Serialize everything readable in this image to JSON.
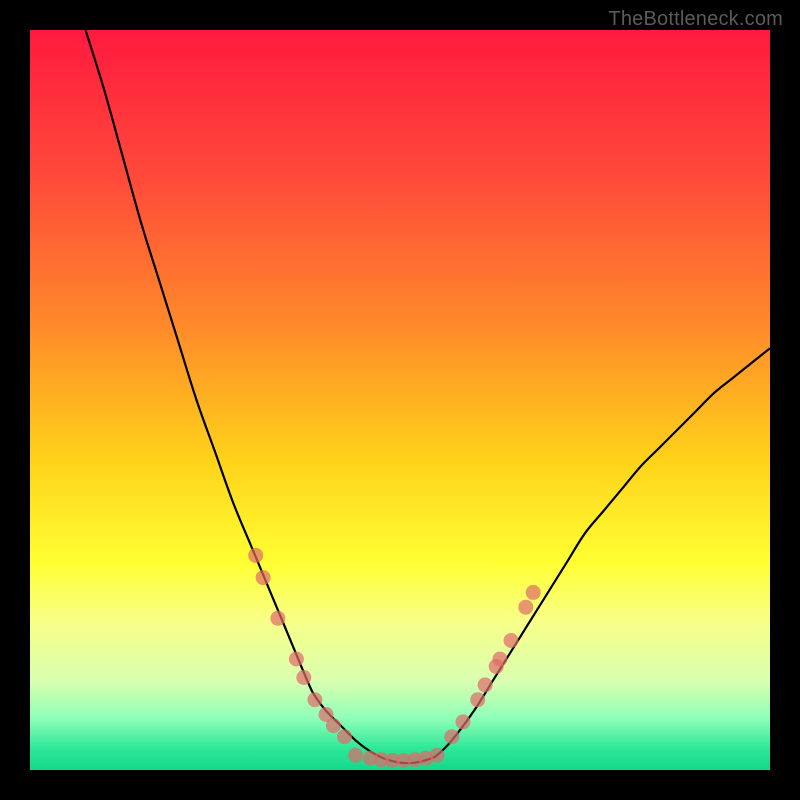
{
  "watermark": "TheBottleneck.com",
  "chart_data": {
    "type": "line",
    "title": "",
    "xlabel": "",
    "ylabel": "",
    "xlim": [
      0,
      100
    ],
    "ylim": [
      0,
      100
    ],
    "grid": false,
    "legend": false,
    "gradient_stops": [
      {
        "pos": 0.0,
        "color": "#ff1a3f"
      },
      {
        "pos": 0.2,
        "color": "#ff4a3a"
      },
      {
        "pos": 0.4,
        "color": "#ff8a2a"
      },
      {
        "pos": 0.58,
        "color": "#ffd21a"
      },
      {
        "pos": 0.72,
        "color": "#ffff33"
      },
      {
        "pos": 0.8,
        "color": "#f8ff88"
      },
      {
        "pos": 0.88,
        "color": "#d8ffb0"
      },
      {
        "pos": 0.93,
        "color": "#8fffb8"
      },
      {
        "pos": 0.97,
        "color": "#30e89a"
      },
      {
        "pos": 1.0,
        "color": "#14d88a"
      }
    ],
    "series": [
      {
        "name": "curve",
        "x": [
          7.5,
          10,
          12.5,
          15,
          17.5,
          20,
          22.5,
          25,
          27.5,
          30,
          32.5,
          35,
          37.5,
          38.5,
          40,
          42,
          44,
          46,
          48,
          50,
          52,
          54,
          55,
          57,
          60,
          62.5,
          65,
          67.5,
          70,
          72.5,
          75,
          77.5,
          80,
          82.5,
          85,
          87.5,
          90,
          92.5,
          95,
          97.5,
          100
        ],
        "y": [
          100,
          92,
          83,
          74,
          66,
          58,
          50,
          43,
          36,
          30,
          24,
          18,
          12,
          10,
          8,
          6,
          4,
          2.5,
          1.5,
          1,
          1,
          1.5,
          2,
          4,
          8,
          12,
          16,
          20,
          24,
          28,
          32,
          35,
          38,
          41,
          43.5,
          46,
          48.5,
          51,
          53,
          55,
          57
        ]
      }
    ],
    "scatter": {
      "name": "markers",
      "color": "#e06a6a",
      "points": [
        {
          "x": 30.5,
          "y": 29
        },
        {
          "x": 31.5,
          "y": 26
        },
        {
          "x": 33.5,
          "y": 20.5
        },
        {
          "x": 36,
          "y": 15
        },
        {
          "x": 37,
          "y": 12.5
        },
        {
          "x": 38.5,
          "y": 9.5
        },
        {
          "x": 40,
          "y": 7.5
        },
        {
          "x": 41,
          "y": 6
        },
        {
          "x": 42.5,
          "y": 4.5
        },
        {
          "x": 44,
          "y": 2
        },
        {
          "x": 46,
          "y": 1.6
        },
        {
          "x": 47.5,
          "y": 1.4
        },
        {
          "x": 49,
          "y": 1.3
        },
        {
          "x": 50.5,
          "y": 1.3
        },
        {
          "x": 52,
          "y": 1.4
        },
        {
          "x": 53.5,
          "y": 1.6
        },
        {
          "x": 55,
          "y": 2
        },
        {
          "x": 57,
          "y": 4.5
        },
        {
          "x": 58.5,
          "y": 6.5
        },
        {
          "x": 60.5,
          "y": 9.5
        },
        {
          "x": 61.5,
          "y": 11.5
        },
        {
          "x": 63,
          "y": 14
        },
        {
          "x": 63.5,
          "y": 15
        },
        {
          "x": 65,
          "y": 17.5
        },
        {
          "x": 67,
          "y": 22
        },
        {
          "x": 68,
          "y": 24
        }
      ]
    }
  }
}
